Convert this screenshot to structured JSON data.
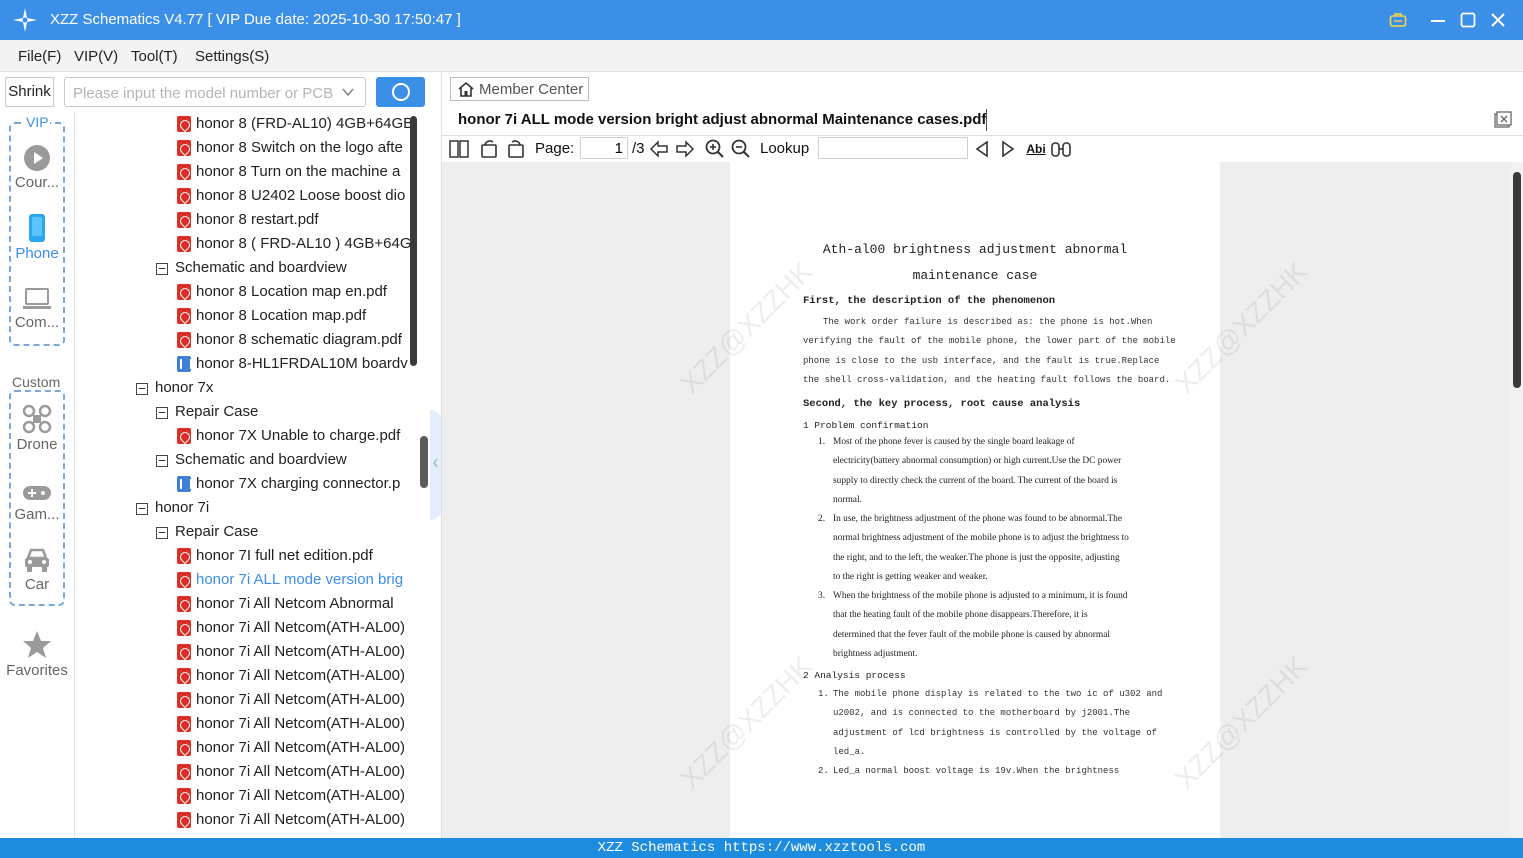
{
  "window": {
    "title": "XZZ Schematics V4.77 [ VIP Due date: 2025-10-30 17:50:47 ]",
    "accent_color": "#3c8fe6",
    "controls": [
      "vip-icon",
      "minimize-icon",
      "maximize-icon",
      "close-icon"
    ]
  },
  "menu": {
    "items": [
      "File(F)",
      "VIP(V)",
      "Tool(T)",
      "Settings(S)"
    ]
  },
  "search": {
    "shrink_label": "Shrink",
    "placeholder": "Please input the model number or PCB",
    "value": ""
  },
  "categories": {
    "vip_group_title": "VIP",
    "custom_group_title": "Custom",
    "items": [
      {
        "label": "Cour...",
        "icon": "play-circle-icon"
      },
      {
        "label": "Phone",
        "icon": "phone-icon",
        "active": true
      },
      {
        "label": "Com...",
        "icon": "laptop-icon"
      },
      {
        "label": "Drone",
        "icon": "drone-icon"
      },
      {
        "label": "Gam...",
        "icon": "gamepad-icon"
      },
      {
        "label": "Car",
        "icon": "car-icon"
      },
      {
        "label": "Favorites",
        "icon": "star-icon"
      }
    ]
  },
  "tree": {
    "nodes": [
      {
        "label": "honor 8 (FRD-AL10) 4GB+64GB",
        "kind": "pdf",
        "level": 3
      },
      {
        "label": "honor 8 Switch on the logo afte",
        "kind": "pdf",
        "level": 3
      },
      {
        "label": "honor 8 Turn on the machine a",
        "kind": "pdf",
        "level": 3
      },
      {
        "label": "honor 8 U2402 Loose boost dio",
        "kind": "pdf",
        "level": 3
      },
      {
        "label": "honor 8 restart.pdf",
        "kind": "pdf",
        "level": 3
      },
      {
        "label": "honor 8 ( FRD-AL10 ) 4GB+64G",
        "kind": "pdf",
        "level": 3
      },
      {
        "label": "Schematic and boardview",
        "kind": "folder",
        "level": 2
      },
      {
        "label": "honor 8 Location map en.pdf",
        "kind": "pdf",
        "level": 3
      },
      {
        "label": "honor 8 Location map.pdf",
        "kind": "pdf",
        "level": 3
      },
      {
        "label": "honor 8 schematic diagram.pdf",
        "kind": "pdf",
        "level": 3
      },
      {
        "label": "honor 8-HL1FRDAL10M boardv",
        "kind": "board",
        "level": 3
      },
      {
        "label": "honor 7x",
        "kind": "folder",
        "level": 1
      },
      {
        "label": "Repair Case",
        "kind": "folder",
        "level": 2
      },
      {
        "label": "honor 7X Unable to charge.pdf",
        "kind": "pdf",
        "level": 3
      },
      {
        "label": "Schematic and boardview",
        "kind": "folder",
        "level": 2
      },
      {
        "label": "honor 7X charging connector.p",
        "kind": "board",
        "level": 3
      },
      {
        "label": "honor 7i",
        "kind": "folder",
        "level": 1
      },
      {
        "label": "Repair Case",
        "kind": "folder",
        "level": 2
      },
      {
        "label": "honor 7I full net edition.pdf",
        "kind": "pdf",
        "level": 3
      },
      {
        "label": "honor 7i ALL mode version brig",
        "kind": "pdf",
        "level": 3,
        "selected": true
      },
      {
        "label": "honor 7i All Netcom Abnormal",
        "kind": "pdf",
        "level": 3
      },
      {
        "label": "honor 7i All Netcom(ATH-AL00)",
        "kind": "pdf",
        "level": 3
      },
      {
        "label": "honor 7i All Netcom(ATH-AL00)",
        "kind": "pdf",
        "level": 3
      },
      {
        "label": "honor 7i All Netcom(ATH-AL00)",
        "kind": "pdf",
        "level": 3
      },
      {
        "label": "honor 7i All Netcom(ATH-AL00)",
        "kind": "pdf",
        "level": 3
      },
      {
        "label": "honor 7i All Netcom(ATH-AL00)",
        "kind": "pdf",
        "level": 3
      },
      {
        "label": "honor 7i All Netcom(ATH-AL00)",
        "kind": "pdf",
        "level": 3
      },
      {
        "label": "honor 7i All Netcom(ATH-AL00)",
        "kind": "pdf",
        "level": 3
      },
      {
        "label": "honor 7i All Netcom(ATH-AL00)",
        "kind": "pdf",
        "level": 3
      },
      {
        "label": "honor 7i All Netcom(ATH-AL00)",
        "kind": "pdf",
        "level": 3
      }
    ]
  },
  "viewer": {
    "member_center_label": "Member Center",
    "doc_tab_title": "honor 7i ALL mode version bright adjust abnormal Maintenance cases.pdf",
    "page_label": "Page:",
    "page_current": "1",
    "page_total": "/3",
    "lookup_label": "Lookup",
    "lookup_value": "",
    "abi_label": "Abi"
  },
  "document": {
    "watermark": "XZZ@XZZHK",
    "title_line1": "Ath-al00 brightness adjustment abnormal",
    "title_line2": "maintenance case",
    "section1": "First, the description of the phenomenon",
    "para1": [
      "The work order failure is described as: the phone is hot.When",
      "verifying the fault of the mobile phone, the lower part of the mobile",
      "phone is close to the usb interface, and the fault is true.Replace",
      "the shell cross-validation, and the heating fault follows the board."
    ],
    "section2": "Second, the key process, root cause analysis",
    "sub1": "1 Problem confirmation",
    "items1": [
      {
        "num": "1.",
        "lines": [
          "Most of the phone fever is caused by the single board leakage of",
          "electricity(battery abnormal consumption) or high current.Use the DC power",
          "supply to directly check the current of the board. The current of the board is",
          "normal."
        ]
      },
      {
        "num": "2.",
        "lines": [
          "In use, the brightness adjustment of the phone was found to be abnormal.The",
          "normal brightness adjustment of the mobile phone is to adjust the brightness to",
          "the right, and to the left, the weaker.The phone is just the opposite, adjusting",
          "to the right is getting weaker and weaker."
        ]
      },
      {
        "num": "3.",
        "lines": [
          "When the brightness of the mobile phone is adjusted to a minimum, it is found",
          "that the heating fault of the mobile phone disappears.Therefore, it is",
          "determined that the fever fault of the mobile phone is caused by abnormal",
          "brightness adjustment."
        ]
      }
    ],
    "sub2": "2  Analysis process",
    "items2": [
      {
        "num": "1.",
        "lines": [
          "The mobile phone display is related to the two ic of u302 and",
          "u2002, and is connected to the motherboard by j2001.The",
          "adjustment of lcd brightness is controlled by the voltage of",
          "led_a."
        ]
      },
      {
        "num": "2.",
        "lines": [
          "Led_a normal boost voltage is 19v.When the brightness"
        ]
      }
    ]
  },
  "status": {
    "text": "XZZ Schematics https://www.xzztools.com"
  }
}
